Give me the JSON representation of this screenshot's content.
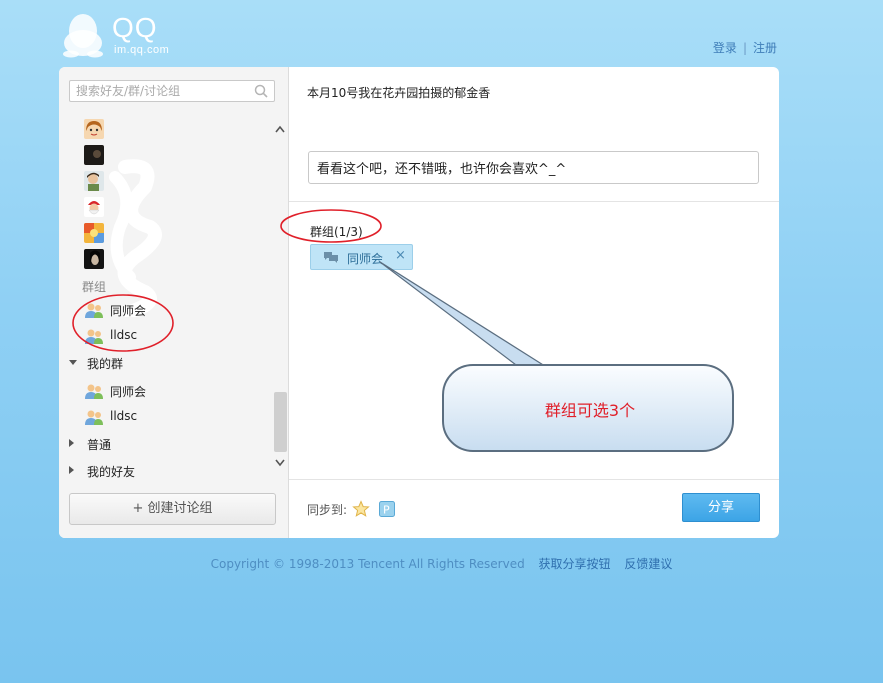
{
  "brand": {
    "logo_text": "QQ",
    "logo_sub": "im.qq.com"
  },
  "header": {
    "login": "登录",
    "separator": "|",
    "register": "注册"
  },
  "search": {
    "placeholder": "搜索好友/群/讨论组"
  },
  "sidebar": {
    "friends": [
      {
        "avatar": "avatar-cartoon-girl",
        "label": ""
      },
      {
        "avatar": "avatar-dark-photo",
        "label": ""
      },
      {
        "avatar": "avatar-boy-photo",
        "label": ""
      },
      {
        "avatar": "avatar-santa",
        "label": ""
      },
      {
        "avatar": "avatar-colorful",
        "label": ""
      },
      {
        "avatar": "avatar-dark-portrait",
        "label": ""
      }
    ],
    "groups_section": "群组",
    "groups": [
      {
        "label": "同师会"
      },
      {
        "label": "lldsc"
      }
    ],
    "my_groups_label": "我的群",
    "my_groups": [
      {
        "label": "同师会"
      },
      {
        "label": "lldsc"
      }
    ],
    "normal_label": "普通",
    "my_friends_label": "我的好友",
    "create_button": "+ 创建讨论组"
  },
  "share": {
    "title": "本月10号我在花卉园拍摄的郁金香",
    "message": "看看这个吧，还不错哦，也许你会喜欢^_^",
    "group_count": "群组(1/3)",
    "selected_tag": "同师会",
    "tag_close": "×",
    "sync_label": "同步到:",
    "share_button": "分享"
  },
  "annotation": {
    "callout_text": "群组可选3个"
  },
  "footer": {
    "copyright": "Copyright © 1998-2013 Tencent All Rights Reserved",
    "get_button": "获取分享按钮",
    "feedback": "反馈建议"
  },
  "colors": {
    "accent": "#3ca4e6",
    "annotation_red": "#e0202a",
    "background": "#8fd0f4"
  }
}
